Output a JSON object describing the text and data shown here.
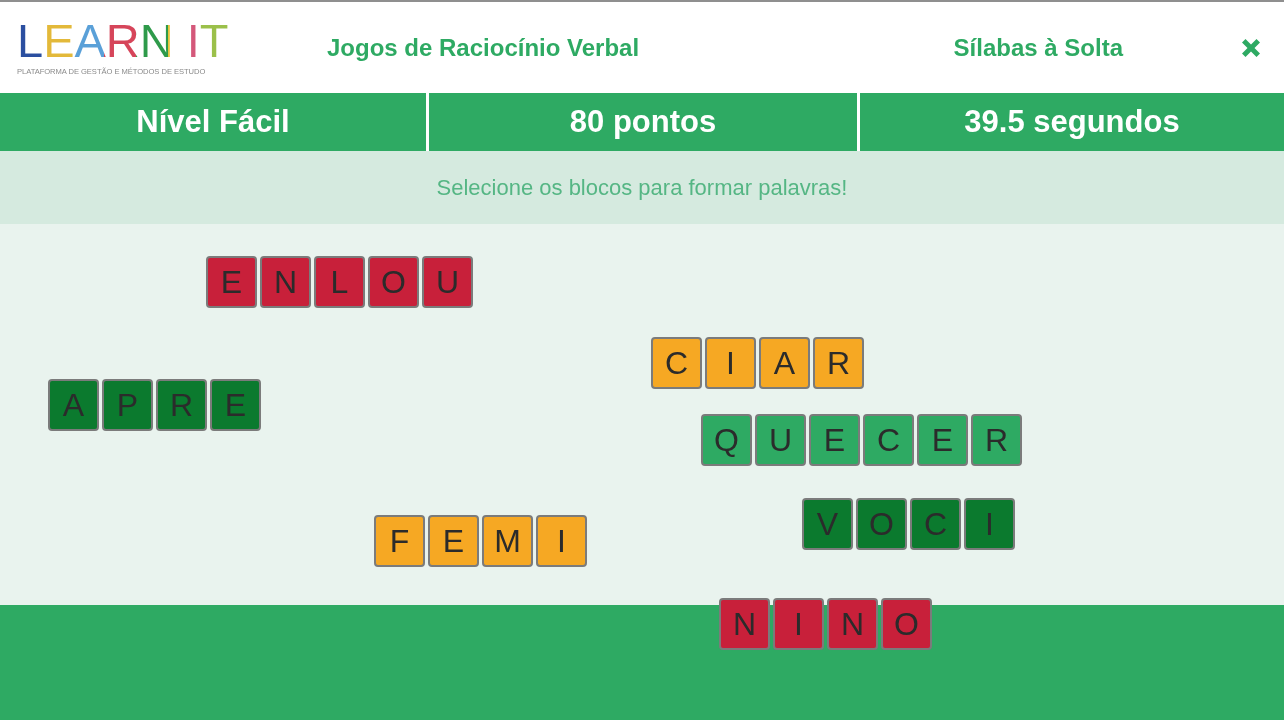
{
  "header": {
    "logo": {
      "wordmark": "LEARN IT",
      "tagline": "PLATAFORMA DE GESTÃO E MÉTODOS DE ESTUDO"
    },
    "game_category": "Jogos de Raciocínio Verbal",
    "game_title": "Sílabas à Solta"
  },
  "stats": [
    "Nível Fácil",
    "80 pontos",
    "39.5 segundos"
  ],
  "instruction": "Selecione os blocos para formar palavras!",
  "blocks": [
    {
      "tiles": [
        "E",
        "N",
        "L",
        "O",
        "U"
      ],
      "color": "#c8203a"
    },
    {
      "tiles": [
        "C",
        "I",
        "A",
        "R"
      ],
      "color": "#f6a823"
    },
    {
      "tiles": [
        "A",
        "P",
        "R",
        "E"
      ],
      "color": "#0b7a2e"
    },
    {
      "tiles": [
        "Q",
        "U",
        "E",
        "C",
        "E",
        "R"
      ],
      "color": "#2eaa63"
    },
    {
      "tiles": [
        "V",
        "O",
        "C",
        "I"
      ],
      "color": "#0b7a2e"
    },
    {
      "tiles": [
        "F",
        "E",
        "M",
        "I"
      ],
      "color": "#f6a823"
    },
    {
      "tiles": [
        "N",
        "I",
        "N",
        "O"
      ],
      "color": "#c8203a"
    }
  ]
}
